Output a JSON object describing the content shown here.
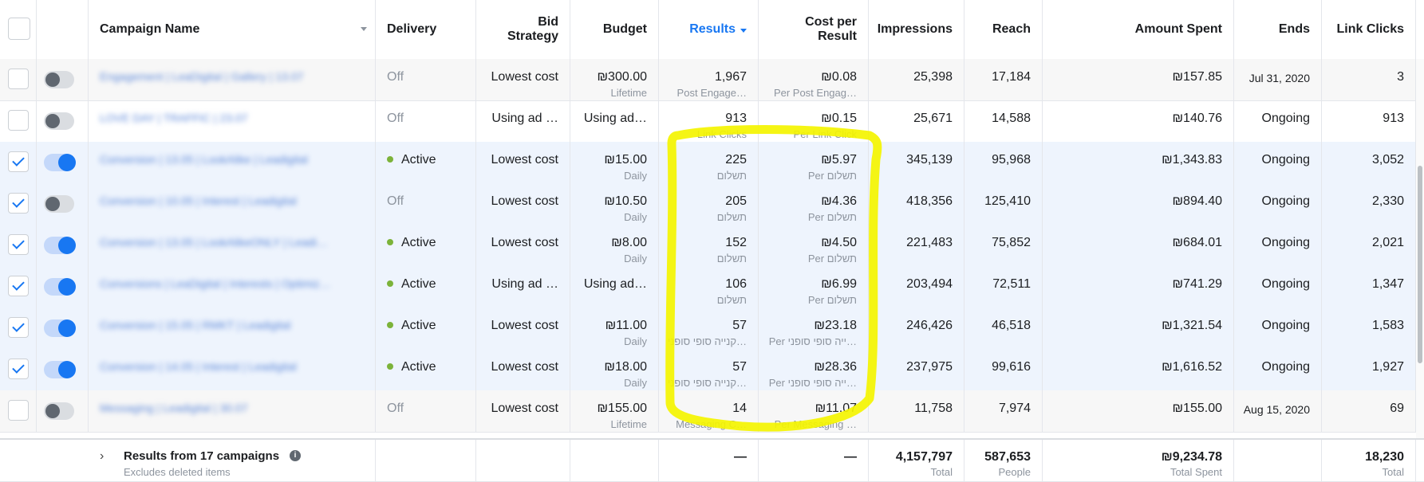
{
  "header": {
    "campaign_name": "Campaign Name",
    "delivery": "Delivery",
    "bid_strategy": "Bid Strategy",
    "budget": "Budget",
    "results": "Results",
    "cost_per_result": "Cost per Result",
    "impressions": "Impressions",
    "reach": "Reach",
    "amount_spent": "Amount Spent",
    "ends": "Ends",
    "link_clicks": "Link Clicks"
  },
  "rows": [
    {
      "checked": false,
      "toggle": false,
      "name": "Engagement | LeaDigital | Gallery | 13.07",
      "delivery": "Off",
      "active": false,
      "bid": "Lowest cost",
      "budget": "₪300.00",
      "budget_sub": "Lifetime",
      "results": "1,967",
      "results_sub": "Post Engage…",
      "cost": "₪0.08",
      "cost_sub": "Per Post Engag…",
      "impressions": "25,398",
      "reach": "17,184",
      "spent": "₪157.85",
      "ends": "Jul 31, 2020",
      "clicks": "3"
    },
    {
      "checked": false,
      "toggle": false,
      "name": "LOVE DAY | TRAFFIC | 23.07",
      "delivery": "Off",
      "active": false,
      "bid": "Using ad …",
      "budget": "Using ad…",
      "budget_sub": "",
      "results": "913",
      "results_sub": "Link Clicks",
      "cost": "₪0.15",
      "cost_sub": "Per Link Click",
      "impressions": "25,671",
      "reach": "14,588",
      "spent": "₪140.76",
      "ends": "Ongoing",
      "clicks": "913"
    },
    {
      "checked": true,
      "toggle": true,
      "name": "Conversion | 13.05 | LookAlike | Leadigital",
      "delivery": "Active",
      "active": true,
      "bid": "Lowest cost",
      "budget": "₪15.00",
      "budget_sub": "Daily",
      "results": "225",
      "results_sub": "תשלום",
      "cost": "₪5.97",
      "cost_sub": "Per תשלום",
      "impressions": "345,139",
      "reach": "95,968",
      "spent": "₪1,343.83",
      "ends": "Ongoing",
      "clicks": "3,052"
    },
    {
      "checked": true,
      "toggle": false,
      "name": "Conversion | 10.05 | Interest | Leadigital",
      "delivery": "Off",
      "active": false,
      "bid": "Lowest cost",
      "budget": "₪10.50",
      "budget_sub": "Daily",
      "results": "205",
      "results_sub": "תשלום",
      "cost": "₪4.36",
      "cost_sub": "Per תשלום",
      "impressions": "418,356",
      "reach": "125,410",
      "spent": "₪894.40",
      "ends": "Ongoing",
      "clicks": "2,330"
    },
    {
      "checked": true,
      "toggle": true,
      "name": "Conversion | 13.05 | LookAlikeONLY | Leadi…",
      "delivery": "Active",
      "active": true,
      "bid": "Lowest cost",
      "budget": "₪8.00",
      "budget_sub": "Daily",
      "results": "152",
      "results_sub": "תשלום",
      "cost": "₪4.50",
      "cost_sub": "Per תשלום",
      "impressions": "221,483",
      "reach": "75,852",
      "spent": "₪684.01",
      "ends": "Ongoing",
      "clicks": "2,021"
    },
    {
      "checked": true,
      "toggle": true,
      "name": "Conversions | LeaDigital | Interests | Optimiz…",
      "delivery": "Active",
      "active": true,
      "bid": "Using ad …",
      "budget": "Using ad…",
      "budget_sub": "",
      "results": "106",
      "results_sub": "תשלום",
      "cost": "₪6.99",
      "cost_sub": "Per תשלום",
      "impressions": "203,494",
      "reach": "72,511",
      "spent": "₪741.29",
      "ends": "Ongoing",
      "clicks": "1,347"
    },
    {
      "checked": true,
      "toggle": true,
      "name": "Conversion | 15.05 | RMKT | Leadigital",
      "delivery": "Active",
      "active": true,
      "bid": "Lowest cost",
      "budget": "₪11.00",
      "budget_sub": "Daily",
      "results": "57",
      "results_sub": "קנייה סופי סופני…",
      "cost": "₪23.18",
      "cost_sub": "Per ייה סופי סופני…",
      "impressions": "246,426",
      "reach": "46,518",
      "spent": "₪1,321.54",
      "ends": "Ongoing",
      "clicks": "1,583"
    },
    {
      "checked": true,
      "toggle": true,
      "name": "Conversion | 14.05 | Interest | Leadigital",
      "delivery": "Active",
      "active": true,
      "bid": "Lowest cost",
      "budget": "₪18.00",
      "budget_sub": "Daily",
      "results": "57",
      "results_sub": "קנייה סופי סופני…",
      "cost": "₪28.36",
      "cost_sub": "Per ייה סופי סופני…",
      "impressions": "237,975",
      "reach": "99,616",
      "spent": "₪1,616.52",
      "ends": "Ongoing",
      "clicks": "1,927"
    },
    {
      "checked": false,
      "toggle": false,
      "name": "Messaging | Leadigital | 30.07",
      "delivery": "Off",
      "active": false,
      "bid": "Lowest cost",
      "budget": "₪155.00",
      "budget_sub": "Lifetime",
      "results": "14",
      "results_sub": "Messaging C…",
      "cost": "₪11.07",
      "cost_sub": "Per Messaging …",
      "impressions": "11,758",
      "reach": "7,974",
      "spent": "₪155.00",
      "ends": "Aug 15, 2020",
      "clicks": "69"
    }
  ],
  "footer": {
    "title": "Results from 17 campaigns",
    "subtitle": "Excludes deleted items",
    "results": "—",
    "cost": "—",
    "impressions": "4,157,797",
    "impressions_sub": "Total",
    "reach": "587,653",
    "reach_sub": "People",
    "spent": "₪9,234.78",
    "spent_sub": "Total Spent",
    "clicks": "18,230",
    "clicks_sub": "Total"
  },
  "colors": {
    "accent": "#1877f2",
    "active_dot": "#7cb33a",
    "highlight": "#f4f400",
    "selected_row": "#eef4fd"
  }
}
